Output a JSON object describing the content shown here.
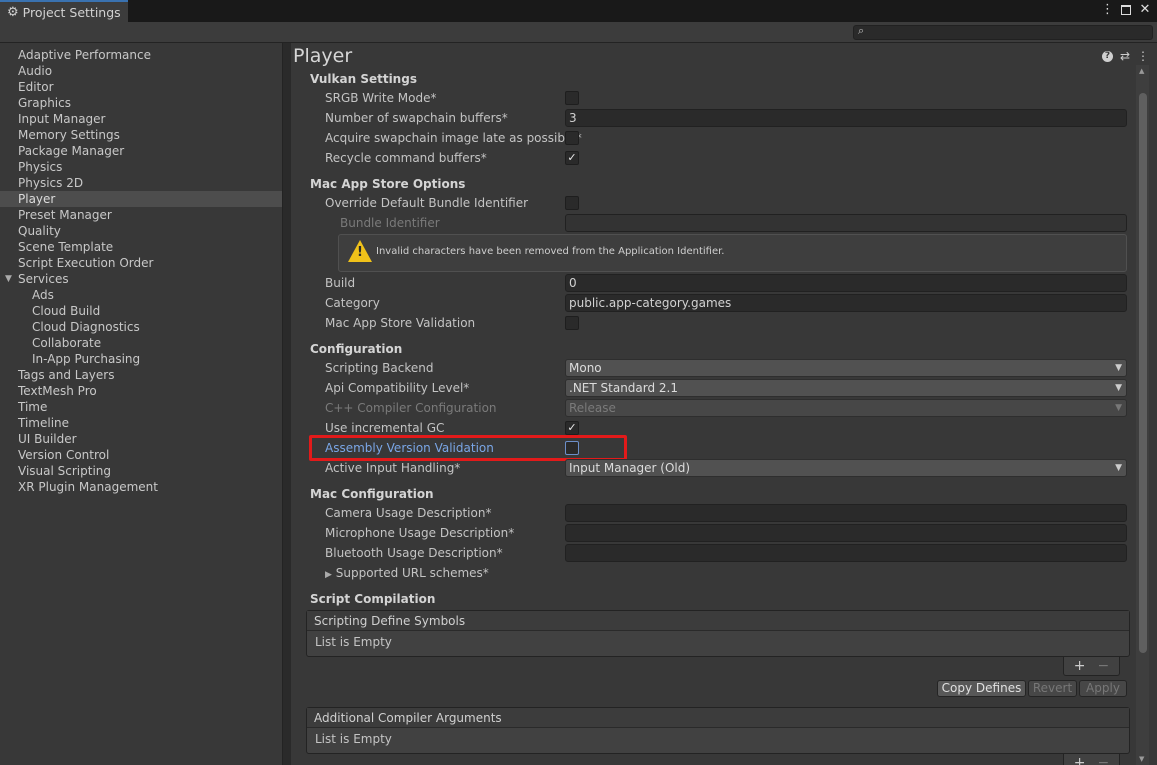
{
  "window": {
    "tab_title": "Project Settings",
    "search": {
      "value": "",
      "placeholder": ""
    }
  },
  "sidebar": {
    "items": [
      {
        "label": "Adaptive Performance"
      },
      {
        "label": "Audio"
      },
      {
        "label": "Editor"
      },
      {
        "label": "Graphics"
      },
      {
        "label": "Input Manager"
      },
      {
        "label": "Memory Settings"
      },
      {
        "label": "Package Manager"
      },
      {
        "label": "Physics"
      },
      {
        "label": "Physics 2D"
      },
      {
        "label": "Player",
        "selected": true
      },
      {
        "label": "Preset Manager"
      },
      {
        "label": "Quality"
      },
      {
        "label": "Scene Template"
      },
      {
        "label": "Script Execution Order"
      },
      {
        "label": "Services",
        "expanded": true
      },
      {
        "label": "Ads",
        "child": true
      },
      {
        "label": "Cloud Build",
        "child": true
      },
      {
        "label": "Cloud Diagnostics",
        "child": true
      },
      {
        "label": "Collaborate",
        "child": true
      },
      {
        "label": "In-App Purchasing",
        "child": true
      },
      {
        "label": "Tags and Layers"
      },
      {
        "label": "TextMesh Pro"
      },
      {
        "label": "Time"
      },
      {
        "label": "Timeline"
      },
      {
        "label": "UI Builder"
      },
      {
        "label": "Version Control"
      },
      {
        "label": "Visual Scripting"
      },
      {
        "label": "XR Plugin Management"
      }
    ]
  },
  "main": {
    "title": "Player",
    "vulkan": {
      "header": "Vulkan Settings",
      "srgb_label": "SRGB Write Mode*",
      "srgb_checked": false,
      "swapchain_label": "Number of swapchain buffers*",
      "swapchain_value": "3",
      "acquire_label": "Acquire swapchain image late as possible*",
      "acquire_checked": false,
      "recycle_label": "Recycle command buffers*",
      "recycle_checked": true
    },
    "mac_app_store": {
      "header": "Mac App Store Options",
      "override_label": "Override Default Bundle Identifier",
      "override_checked": false,
      "bundle_label": "Bundle Identifier",
      "bundle_value": "",
      "warning_text": "Invalid characters have been removed from the Application Identifier.",
      "build_label": "Build",
      "build_value": "0",
      "category_label": "Category",
      "category_value": "public.app-category.games",
      "validation_label": "Mac App Store Validation",
      "validation_checked": false
    },
    "configuration": {
      "header": "Configuration",
      "backend_label": "Scripting Backend",
      "backend_value": "Mono",
      "api_label": "Api Compatibility Level*",
      "api_value": ".NET Standard 2.1",
      "cpp_label": "C++ Compiler Configuration",
      "cpp_value": "Release",
      "incremental_label": "Use incremental GC",
      "incremental_checked": true,
      "assembly_label": "Assembly Version Validation",
      "assembly_checked": false,
      "input_label": "Active Input Handling*",
      "input_value": "Input Manager (Old)"
    },
    "mac_configuration": {
      "header": "Mac Configuration",
      "camera_label": "Camera Usage Description*",
      "camera_value": "",
      "microphone_label": "Microphone Usage Description*",
      "microphone_value": "",
      "bluetooth_label": "Bluetooth Usage Description*",
      "bluetooth_value": "",
      "url_schemes_label": "Supported URL schemes*"
    },
    "script_compilation": {
      "header": "Script Compilation",
      "define_symbols_header": "Scripting Define Symbols",
      "define_symbols_empty": "List is Empty",
      "copy_defines": "Copy Defines",
      "revert": "Revert",
      "apply": "Apply",
      "additional_args_header": "Additional Compiler Arguments",
      "additional_args_empty": "List is Empty",
      "plus": "+",
      "minus": "−"
    }
  },
  "colors": {
    "highlight_box": "#e21a1a",
    "accent_tab": "#3a72b0",
    "blue_label": "#7aa6e6",
    "warning": "#f0c21a"
  }
}
